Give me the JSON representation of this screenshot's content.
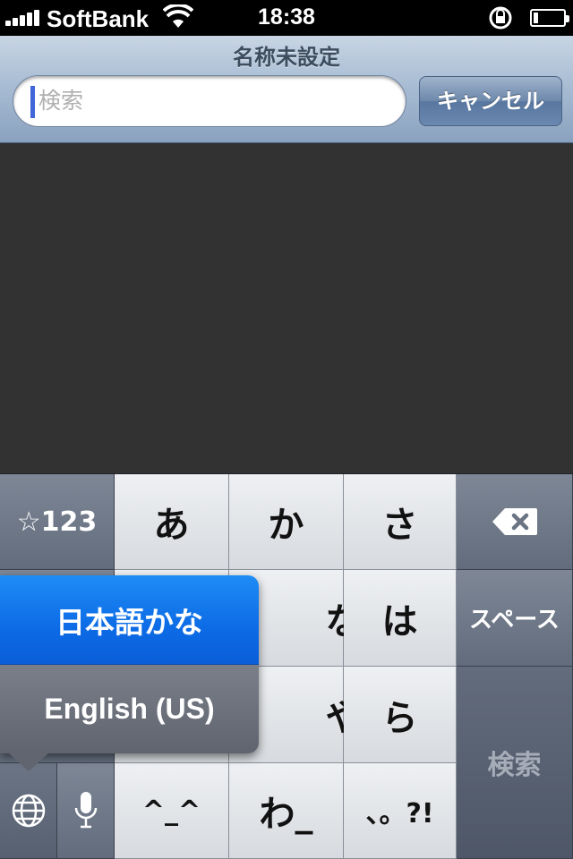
{
  "status_bar": {
    "carrier": "SoftBank",
    "time": "18:38",
    "battery_level": 0.15
  },
  "header": {
    "title": "名称未設定",
    "search_placeholder": "検索",
    "cancel_label": "キャンセル"
  },
  "keyboard": {
    "row1": [
      "☆123",
      "あ",
      "か",
      "さ"
    ],
    "row2": [
      "な",
      "は"
    ],
    "row3": [
      "や",
      "ら"
    ],
    "row4": [
      "^_^",
      "わ_",
      "、。?!"
    ],
    "space_label": "スペース",
    "search_label": "検索",
    "icons": {
      "backspace": "backspace-icon",
      "globe": "globe-icon",
      "mic": "microphone-icon"
    }
  },
  "input_popup": {
    "options": [
      "日本語かな",
      "English (US)"
    ],
    "selected": "日本語かな"
  },
  "colors": {
    "accent_blue": "#0d6be6",
    "caret": "#4066d9",
    "content_bg": "#323232"
  }
}
